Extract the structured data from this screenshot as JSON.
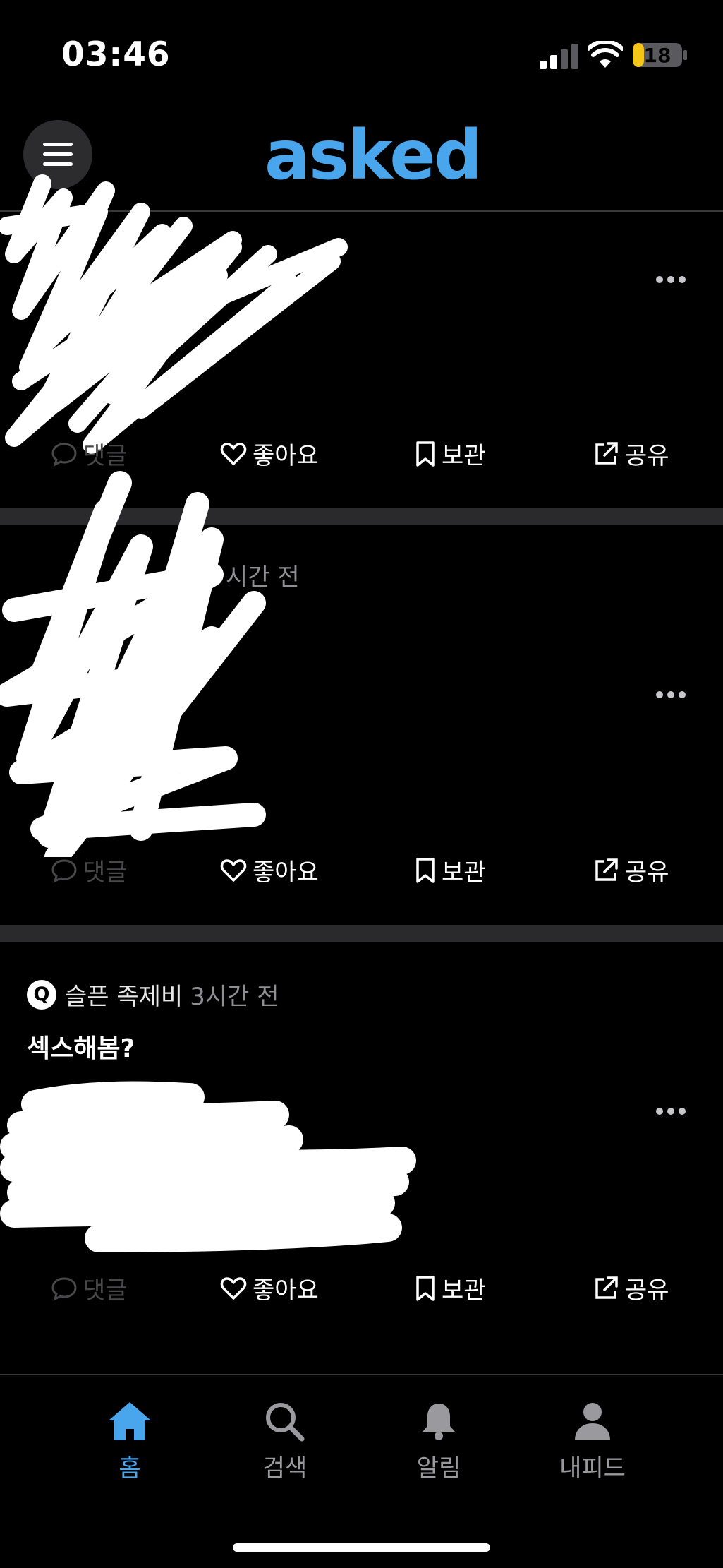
{
  "status_bar": {
    "time": "03:46",
    "battery": "18"
  },
  "header": {
    "logo": "asked",
    "menu_icon": "hamburger-icon"
  },
  "actions": {
    "comment": "댓글",
    "like": "좋아요",
    "save": "보관",
    "share": "공유"
  },
  "cards": [
    {},
    {
      "time_ago": "시간 전"
    },
    {
      "badge": "Q",
      "author": "슬픈 족제비",
      "time_ago": "3시간 전",
      "question": "섹스해봄?"
    }
  ],
  "nav": {
    "home": "홈",
    "search": "검색",
    "notifications": "알림",
    "my_feed": "내피드"
  },
  "colors": {
    "accent": "#4aa6ec",
    "background": "#000000",
    "separator": "#2a2a2c"
  }
}
